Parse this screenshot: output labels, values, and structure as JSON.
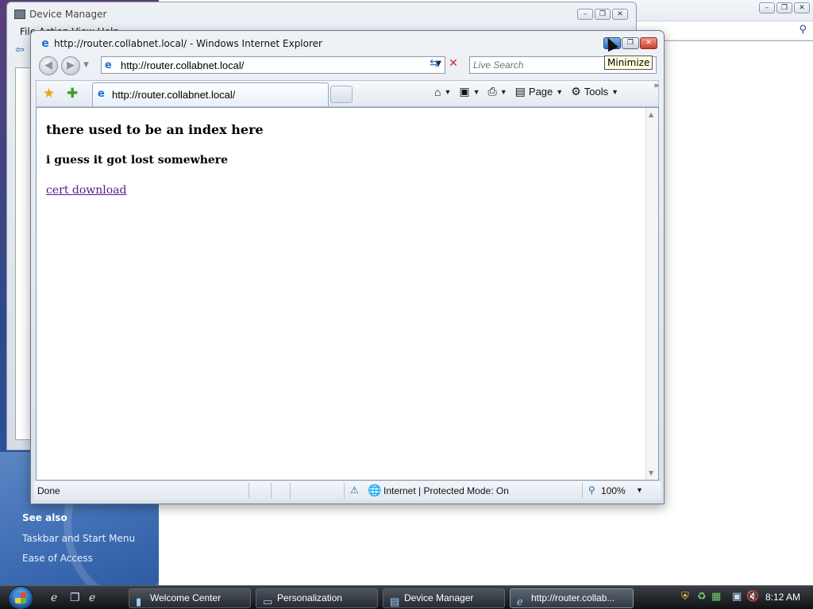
{
  "background": {
    "device_manager": {
      "title": "Device Manager",
      "menu_text": "File   Action   View   Help"
    },
    "right_window": {
      "search_icon": "search-icon"
    },
    "welcome_center": {
      "see_also": "See also",
      "links": [
        "Taskbar and Start Menu",
        "Ease of Access"
      ]
    }
  },
  "ie": {
    "title": "http://router.collabnet.local/ - Windows Internet Explorer",
    "tooltip": "Minimize",
    "address": {
      "value": "http://router.collabnet.local/"
    },
    "search": {
      "placeholder": "Live Search"
    },
    "tab": {
      "label": "http://router.collabnet.local/"
    },
    "commands": {
      "page": "Page",
      "tools": "Tools"
    },
    "content": {
      "heading": "there used to be an index here",
      "subheading": "i guess it got lost somewhere",
      "link": "cert download"
    },
    "status": {
      "text": "Done",
      "zone": "Internet | Protected Mode: On",
      "zoom": "100%"
    }
  },
  "taskbar": {
    "buttons": [
      {
        "label": "Welcome Center"
      },
      {
        "label": "Personalization"
      },
      {
        "label": "Device Manager"
      },
      {
        "label": "http://router.collab..."
      }
    ],
    "clock": "8:12 AM"
  }
}
